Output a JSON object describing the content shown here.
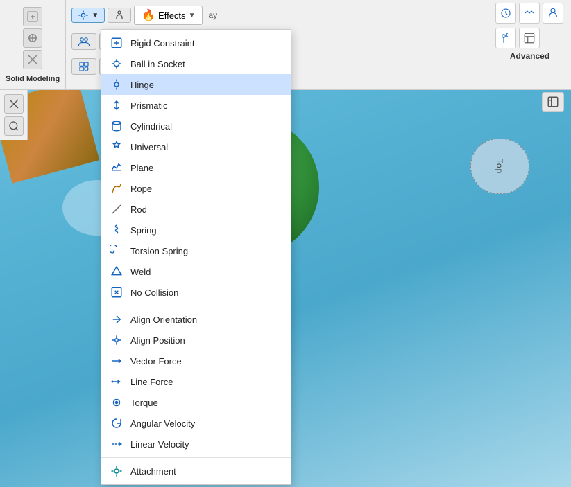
{
  "app": {
    "title": "Solid Modeling"
  },
  "toolbar": {
    "solid_modeling_label": "Solid Modeling",
    "effects_label": "Effects",
    "advanced_label": "Advanced",
    "dropdown_arrow": "▼"
  },
  "dropdown_menu": {
    "items": [
      {
        "id": "rigid-constraint",
        "label": "Rigid Constraint",
        "icon": "⊞",
        "color": "blue",
        "separator_after": false
      },
      {
        "id": "ball-in-socket",
        "label": "Ball in Socket",
        "icon": "⊕",
        "color": "blue",
        "separator_after": false
      },
      {
        "id": "hinge",
        "label": "Hinge",
        "icon": "⊗",
        "color": "blue",
        "separator_after": false,
        "highlighted": true
      },
      {
        "id": "prismatic",
        "label": "Prismatic",
        "icon": "↕",
        "color": "blue",
        "separator_after": false
      },
      {
        "id": "cylindrical",
        "label": "Cylindrical",
        "icon": "⟳",
        "color": "blue",
        "separator_after": false
      },
      {
        "id": "universal",
        "label": "Universal",
        "icon": "✦",
        "color": "blue",
        "separator_after": false
      },
      {
        "id": "plane",
        "label": "Plane",
        "icon": "◇",
        "color": "blue",
        "separator_after": false
      },
      {
        "id": "rope",
        "label": "Rope",
        "icon": "≋",
        "color": "orange",
        "separator_after": false
      },
      {
        "id": "rod",
        "label": "Rod",
        "icon": "╱",
        "color": "gray",
        "separator_after": false
      },
      {
        "id": "spring",
        "label": "Spring",
        "icon": "⌇",
        "color": "blue",
        "separator_after": false
      },
      {
        "id": "torsion-spring",
        "label": "Torsion Spring",
        "icon": "↺",
        "color": "blue",
        "separator_after": false
      },
      {
        "id": "weld",
        "label": "Weld",
        "icon": "⌐",
        "color": "blue",
        "separator_after": false
      },
      {
        "id": "no-collision",
        "label": "No Collision",
        "icon": "⛌",
        "color": "blue",
        "separator_after": true
      },
      {
        "id": "align-orientation",
        "label": "Align Orientation",
        "icon": "⤡",
        "color": "blue",
        "separator_after": false
      },
      {
        "id": "align-position",
        "label": "Align Position",
        "icon": "⊹",
        "color": "blue",
        "separator_after": false
      },
      {
        "id": "vector-force",
        "label": "Vector Force",
        "icon": "→",
        "color": "blue",
        "separator_after": false
      },
      {
        "id": "line-force",
        "label": "Line Force",
        "icon": "⇢",
        "color": "blue",
        "separator_after": false
      },
      {
        "id": "torque",
        "label": "Torque",
        "icon": "◎",
        "color": "blue",
        "separator_after": false
      },
      {
        "id": "angular-velocity",
        "label": "Angular Velocity",
        "icon": "↻",
        "color": "blue",
        "separator_after": false
      },
      {
        "id": "linear-velocity",
        "label": "Linear Velocity",
        "icon": "⋯",
        "color": "blue",
        "separator_after": true
      },
      {
        "id": "attachment",
        "label": "Attachment",
        "icon": "⊛",
        "color": "teal",
        "separator_after": false
      }
    ]
  }
}
